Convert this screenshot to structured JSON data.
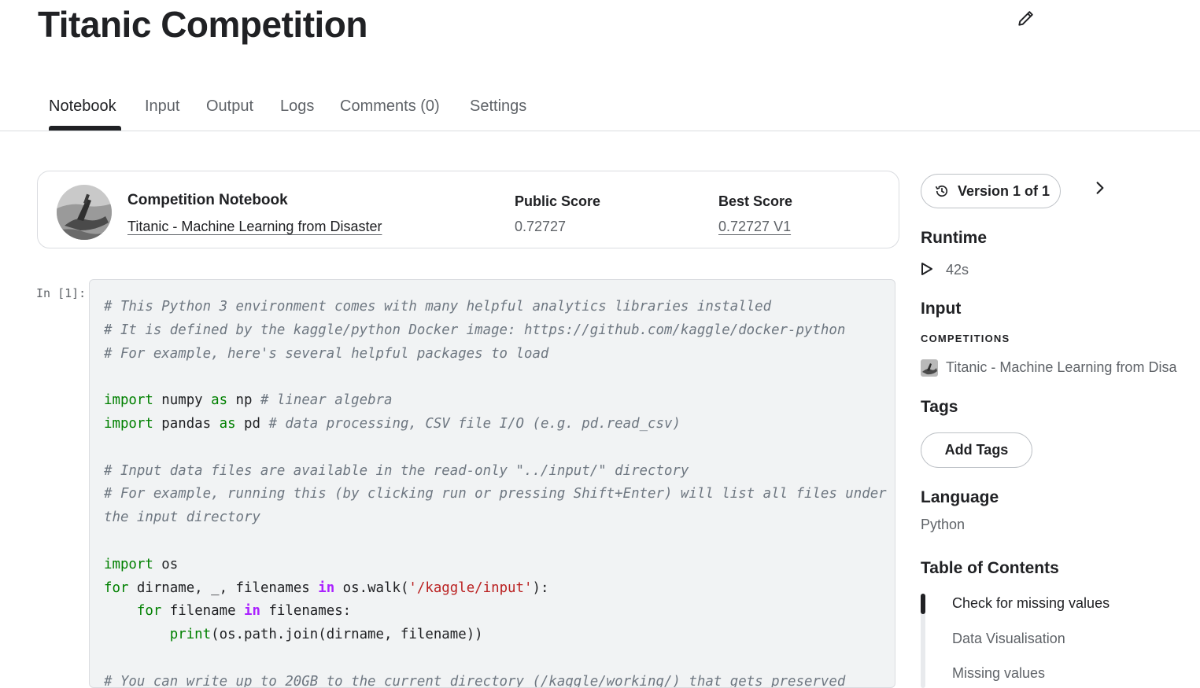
{
  "page": {
    "title": "Titanic Competition"
  },
  "tabs": [
    {
      "label": "Notebook",
      "active": true
    },
    {
      "label": "Input"
    },
    {
      "label": "Output"
    },
    {
      "label": "Logs"
    },
    {
      "label": "Comments (0)"
    },
    {
      "label": "Settings"
    }
  ],
  "competition_card": {
    "heading": "Competition Notebook",
    "competition_link": "Titanic - Machine Learning from Disaster",
    "public_score_label": "Public Score",
    "public_score_value": "0.72727",
    "best_score_label": "Best Score",
    "best_score_value": "0.72727 V1"
  },
  "cell": {
    "prompt": "In [1]:",
    "language": "python"
  },
  "sidebar": {
    "version_label": "Version 1 of 1",
    "runtime_heading": "Runtime",
    "runtime_value": "42s",
    "input_heading": "Input",
    "competitions_caption": "COMPETITIONS",
    "competition_item": "Titanic - Machine Learning from Disa",
    "tags_heading": "Tags",
    "add_tags_label": "Add Tags",
    "language_heading": "Language",
    "language_value": "Python",
    "toc_heading": "Table of Contents",
    "toc_items": [
      {
        "label": "Check for missing values",
        "active": true
      },
      {
        "label": "Data Visualisation"
      },
      {
        "label": "Missing values"
      }
    ]
  },
  "colors": {
    "text_primary": "#202124",
    "text_secondary": "#5f6368",
    "border": "#dadce0",
    "code_background": "#f1f3f4",
    "comment": "#6e7781",
    "keyword": "#008000",
    "operator_word": "#aa22ff",
    "string": "#ba2121"
  },
  "icons": {
    "edit": "pencil-icon",
    "version": "history-icon",
    "next": "chevron-right-icon",
    "runtime": "play-icon",
    "competition_thumb": "titanic-thumbnail-icon"
  }
}
